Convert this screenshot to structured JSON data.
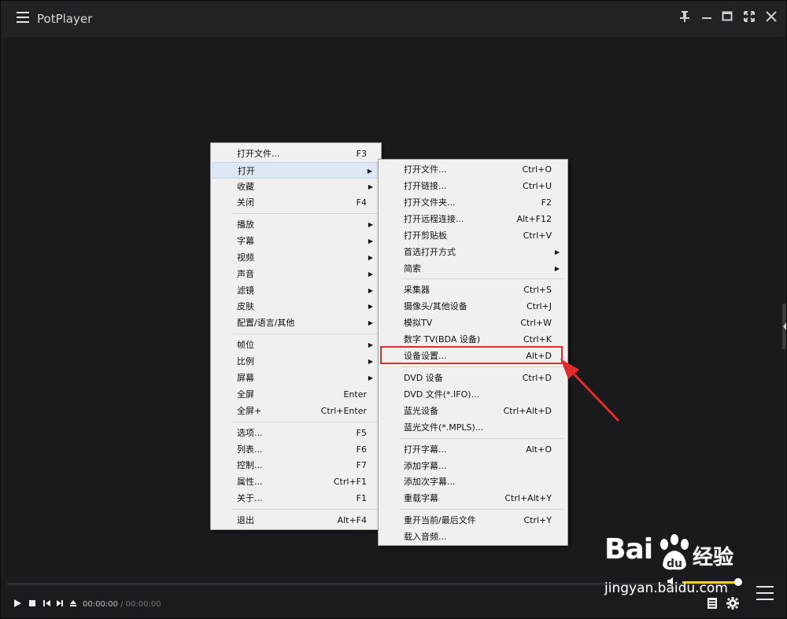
{
  "app": {
    "title": "PotPlayer"
  },
  "window_controls": [
    "pin-icon",
    "minimize-icon",
    "maximize-icon",
    "fullscreen-icon",
    "close-icon"
  ],
  "main_menu": {
    "items": [
      {
        "label": "打开文件...",
        "shortcut": "F3"
      },
      {
        "label": "打开",
        "shortcut": "",
        "submenu": true,
        "highlighted": true
      },
      {
        "label": "收藏",
        "shortcut": "",
        "submenu": true
      },
      {
        "label": "关闭",
        "shortcut": "F4"
      },
      {
        "label": "播放",
        "shortcut": "",
        "submenu": true
      },
      {
        "label": "字幕",
        "shortcut": "",
        "submenu": true
      },
      {
        "label": "视频",
        "shortcut": "",
        "submenu": true
      },
      {
        "label": "声音",
        "shortcut": "",
        "submenu": true
      },
      {
        "label": "滤镜",
        "shortcut": "",
        "submenu": true
      },
      {
        "label": "皮肤",
        "shortcut": "",
        "submenu": true
      },
      {
        "label": "配置/语言/其他",
        "shortcut": "",
        "submenu": true
      },
      {
        "label": "帧位",
        "shortcut": "",
        "submenu": true
      },
      {
        "label": "比例",
        "shortcut": "",
        "submenu": true
      },
      {
        "label": "屏幕",
        "shortcut": "",
        "submenu": true
      },
      {
        "label": "全屏",
        "shortcut": "Enter"
      },
      {
        "label": "全屏+",
        "shortcut": "Ctrl+Enter"
      },
      {
        "label": "选项...",
        "shortcut": "F5"
      },
      {
        "label": "列表...",
        "shortcut": "F6"
      },
      {
        "label": "控制...",
        "shortcut": "F7"
      },
      {
        "label": "属性...",
        "shortcut": "Ctrl+F1"
      },
      {
        "label": "关于...",
        "shortcut": "F1"
      },
      {
        "label": "退出",
        "shortcut": "Alt+F4"
      }
    ]
  },
  "open_submenu": {
    "items": [
      {
        "label": "打开文件...",
        "shortcut": "Ctrl+O"
      },
      {
        "label": "打开链接...",
        "shortcut": "Ctrl+U"
      },
      {
        "label": "打开文件夹...",
        "shortcut": "F2"
      },
      {
        "label": "打开远程连接...",
        "shortcut": "Alt+F12"
      },
      {
        "label": "打开剪贴板",
        "shortcut": "Ctrl+V"
      },
      {
        "label": "首选打开方式",
        "shortcut": "",
        "submenu": true
      },
      {
        "label": "简索",
        "shortcut": "",
        "submenu": true
      },
      {
        "label": "采集器",
        "shortcut": "Ctrl+S"
      },
      {
        "label": "摄像头/其他设备",
        "shortcut": "Ctrl+J"
      },
      {
        "label": "模拟TV",
        "shortcut": "Ctrl+W"
      },
      {
        "label": "数字 TV(BDA 设备)",
        "shortcut": "Ctrl+K"
      },
      {
        "label": "设备设置...",
        "shortcut": "Alt+D",
        "outlined": true
      },
      {
        "label": "DVD 设备",
        "shortcut": "Ctrl+D"
      },
      {
        "label": "DVD 文件(*.IFO)...",
        "shortcut": ""
      },
      {
        "label": "蓝光设备",
        "shortcut": "Ctrl+Alt+D"
      },
      {
        "label": "蓝光文件(*.MPLS)...",
        "shortcut": ""
      },
      {
        "label": "打开字幕...",
        "shortcut": "Alt+O"
      },
      {
        "label": "添加字幕...",
        "shortcut": ""
      },
      {
        "label": "添加次字幕...",
        "shortcut": ""
      },
      {
        "label": "重载字幕",
        "shortcut": "Ctrl+Alt+Y"
      },
      {
        "label": "重开当前/最后文件",
        "shortcut": "Ctrl+Y"
      },
      {
        "label": "载入音频...",
        "shortcut": ""
      }
    ]
  },
  "controls": {
    "current_time": "00:00:00",
    "separator": "/",
    "duration": "00:00:00",
    "volume": 1.0
  },
  "colors": {
    "accent": "#ffd400",
    "highlight_box": "#e22b2b"
  },
  "watermark": {
    "brand": "Bai",
    "brand_cn": "经验",
    "url": "jingyan.baidu.com"
  }
}
